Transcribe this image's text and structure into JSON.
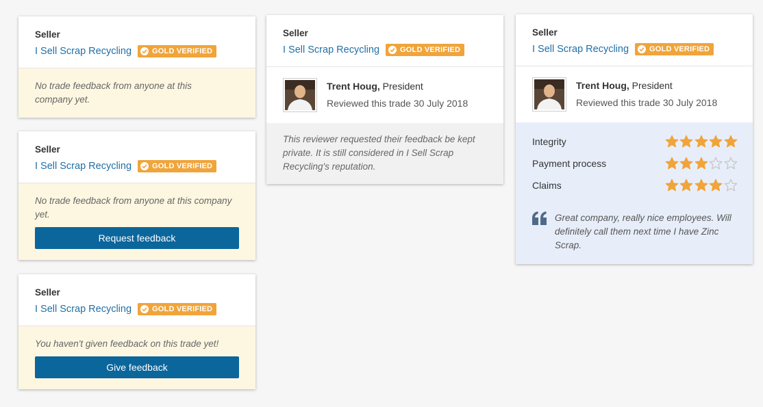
{
  "seller_label": "Seller",
  "company_name": "I Sell Scrap Recycling",
  "badge_text": "GOLD VERIFIED",
  "colors": {
    "badge": "#f0a43a",
    "link": "#1f6fa5",
    "button": "#0b669c",
    "star": "#f0a43a"
  },
  "card1": {
    "message": "No trade feedback from anyone at this company yet."
  },
  "card2": {
    "message": "No trade feedback from anyone at this company yet.",
    "button": "Request feedback"
  },
  "card3": {
    "message": "You haven't given feedback on this trade yet!",
    "button": "Give feedback"
  },
  "card4": {
    "reviewer_name": "Trent Houg,",
    "reviewer_title": "President",
    "reviewed_text": "Reviewed this trade 30 July 2018",
    "message": "This reviewer requested their feedback be kept private. It is still considered in I Sell Scrap Recycling's reputation."
  },
  "card5": {
    "reviewer_name": "Trent Houg,",
    "reviewer_title": "President",
    "reviewed_text": "Reviewed this trade 30 July 2018",
    "ratings": [
      {
        "label": "Integrity",
        "stars": 5,
        "max": 5
      },
      {
        "label": "Payment process",
        "stars": 3,
        "max": 5
      },
      {
        "label": "Claims",
        "stars": 4,
        "max": 5
      }
    ],
    "quote": "Great company, really nice employees. Will definitely call them next time I have Zinc Scrap.",
    "quote_icon": "quote-icon"
  }
}
